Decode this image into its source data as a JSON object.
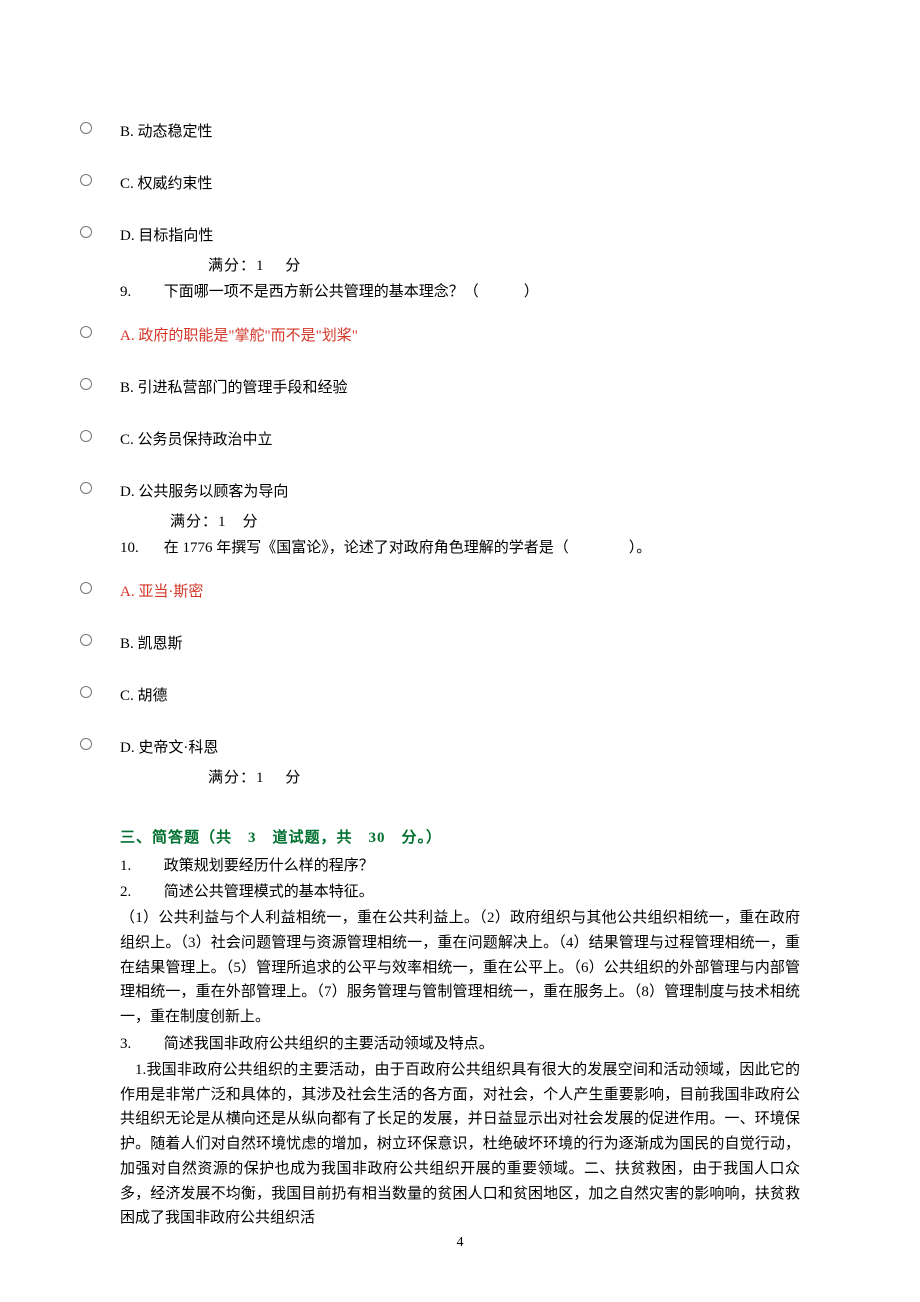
{
  "q8_options": {
    "b": "B. 动态稳定性",
    "c": "C. 权威约束性",
    "d": "D. 目标指向性"
  },
  "q8_score": "满分：1　 分",
  "q9": {
    "num": "9.",
    "text": "下面哪一项不是西方新公共管理的基本理念？（　　　）",
    "a": "A. 政府的职能是\"掌舵\"而不是\"划桨\"",
    "b": "B. 引进私营部门的管理手段和经验",
    "c": "C. 公务员保持政治中立",
    "d": "D. 公共服务以顾客为导向",
    "score": "满分：1　分"
  },
  "q10": {
    "num": "10.",
    "text": "在 1776 年撰写《国富论》，论述了对政府角色理解的学者是（　　　　）。",
    "a": "A. 亚当·斯密",
    "b": "B. 凯恩斯",
    "c": "C. 胡德",
    "d": "D. 史帝文·科恩",
    "score": "满分：1　 分"
  },
  "section3": {
    "title": "三、简答题（共　3　道试题，共　30　分。）",
    "q1": {
      "num": "1.",
      "text": "政策规划要经历什么样的程序？"
    },
    "q2": {
      "num": "2.",
      "text": "简述公共管理模式的基本特征。",
      "answer": "（1）公共利益与个人利益相统一，重在公共利益上。（2）政府组织与其他公共组织相统一，重在政府组织上。（3）社会问题管理与资源管理相统一，重在问题解决上。（4）结果管理与过程管理相统一，重在结果管理上。（5）管理所追求的公平与效率相统一，重在公平上。（6）公共组织的外部管理与内部管理相统一，重在外部管理上。（7）服务管理与管制管理相统一，重在服务上。（8）管理制度与技术相统一，重在制度创新上。"
    },
    "q3": {
      "num": "3.",
      "text": "简述我国非政府公共组织的主要活动领域及特点。",
      "answer": "1.我国非政府公共组织的主要活动，由于百政府公共组织具有很大的发展空间和活动领域，因此它的作用是非常广泛和具体的，其涉及社会生活的各方面，对社会，个人产生重要影响，目前我国非政府公共组织无论是从横向还是从纵向都有了长足的发展，并日益显示出对社会发展的促进作用。一、环境保护。随着人们对自然环境忧虑的增加，树立环保意识，杜绝破坏环境的行为逐渐成为国民的自觉行动，加强对自然资源的保护也成为我国非政府公共组织开展的重要领域。二、扶贫救困，由于我国人口众多，经济发展不均衡，我国目前扔有相当数量的贫困人口和贫困地区，加之自然灾害的影响响，扶贫救困成了我国非政府公共组织活"
    }
  },
  "page_number": "4"
}
